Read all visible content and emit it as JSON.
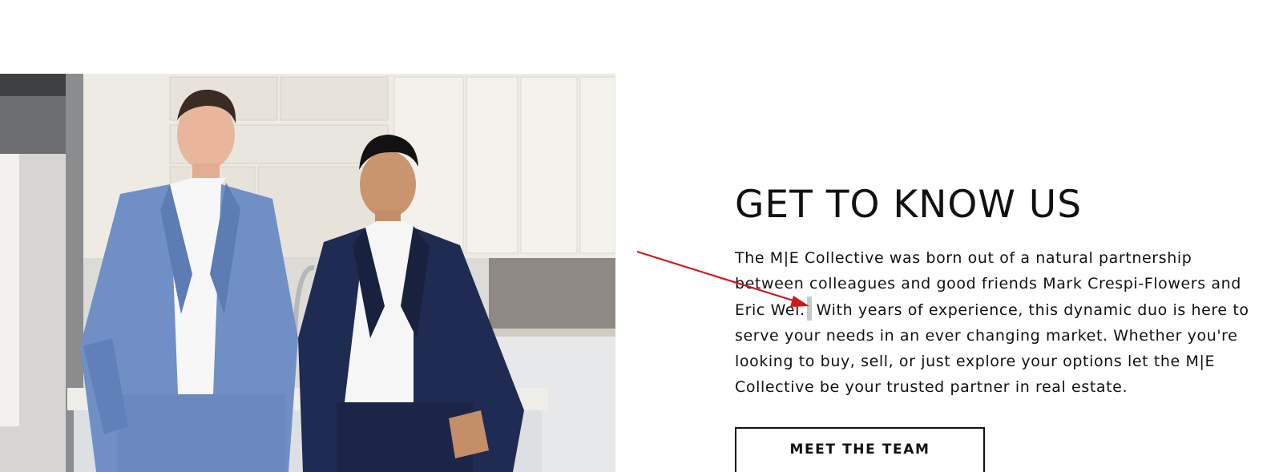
{
  "section": {
    "heading": "GET TO KNOW US",
    "body_before": "The M|E Collective was born out of a natural partnership between colleagues and good friends Mark Crespi-Flowers and Eric Wei.",
    "body_after": "With years of experience, this dynamic duo is here to serve your needs in an ever changing market. Whether you're looking to buy, sell, or just explore your options let the M|E Collective be your trusted partner in real estate.",
    "cta_label": "MEET THE TEAM"
  },
  "photo": {
    "subject": "team-photo"
  },
  "colors": {
    "text": "#111111",
    "background": "#ffffff",
    "annotation_arrow": "#d0191b",
    "button_border": "#111111"
  },
  "icons": {
    "annotation": "arrow-icon"
  }
}
